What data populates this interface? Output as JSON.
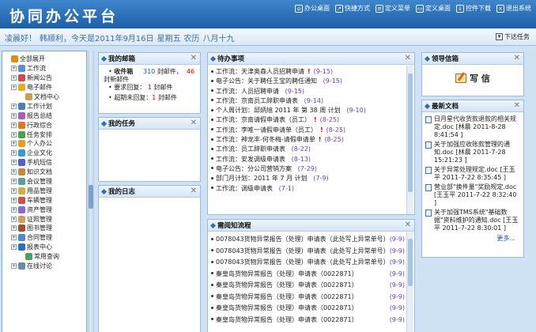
{
  "header": {
    "title": "协同办公平台",
    "nav": [
      {
        "label": "办公桌面",
        "icon": "home-icon"
      },
      {
        "label": "快捷方式",
        "icon": "shortcut-icon"
      },
      {
        "label": "定义菜单",
        "icon": "menu-icon"
      },
      {
        "label": "定义桌面",
        "icon": "desktop-icon"
      },
      {
        "label": "控件下载",
        "icon": "download-icon"
      },
      {
        "label": "退出系统",
        "icon": "exit-icon"
      }
    ]
  },
  "greeting": {
    "parts": [
      "凌晨好！",
      "韩顺利，今天是2011年9月16日",
      "星期五",
      "农历",
      "八月十九"
    ],
    "download_tasks": "下达任务"
  },
  "sidebar": {
    "items": [
      {
        "label": "全部展开",
        "level": 1,
        "exp": "",
        "color": "#e08a1a"
      },
      {
        "label": "工作流",
        "level": 2,
        "exp": "+",
        "color": "#5a8fd0"
      },
      {
        "label": "新闻公告",
        "level": 2,
        "exp": "+",
        "color": "#d04a4a"
      },
      {
        "label": "电子邮件",
        "level": 2,
        "exp": "+",
        "color": "#e0b020"
      },
      {
        "label": "文档中心",
        "level": 3,
        "exp": "",
        "color": "#c8a050"
      },
      {
        "label": "工作计划",
        "level": 2,
        "exp": "+",
        "color": "#4a7fc0"
      },
      {
        "label": "报告总结",
        "level": 2,
        "exp": "+",
        "color": "#b05ab0"
      },
      {
        "label": "行政综合",
        "level": 2,
        "exp": "+",
        "color": "#e07a20"
      },
      {
        "label": "任务安排",
        "level": 2,
        "exp": "+",
        "color": "#4aa04a"
      },
      {
        "label": "个人办公",
        "level": 2,
        "exp": "+",
        "color": "#e0a020"
      },
      {
        "label": "企业文化",
        "level": 2,
        "exp": "+",
        "color": "#3a9ad0"
      },
      {
        "label": "手机短信",
        "level": 2,
        "exp": "+",
        "color": "#5a5ad0"
      },
      {
        "label": "知识文档",
        "level": 2,
        "exp": "+",
        "color": "#c08a40"
      },
      {
        "label": "会议管理",
        "level": 2,
        "exp": "+",
        "color": "#5aa0a0"
      },
      {
        "label": "用品管理",
        "level": 2,
        "exp": "+",
        "color": "#d0b040"
      },
      {
        "label": "车辆管理",
        "level": 2,
        "exp": "+",
        "color": "#d05050"
      },
      {
        "label": "资产管理",
        "level": 2,
        "exp": "+",
        "color": "#8a6ad0"
      },
      {
        "label": "证照管理",
        "level": 2,
        "exp": "+",
        "color": "#d0a060"
      },
      {
        "label": "图书管理",
        "level": 2,
        "exp": "+",
        "color": "#a05030"
      },
      {
        "label": "合同管理",
        "level": 2,
        "exp": "+",
        "color": "#4a8ad0"
      },
      {
        "label": "报表中心",
        "level": 2,
        "exp": "+",
        "color": "#2a70c0"
      },
      {
        "label": "常用查询",
        "level": 3,
        "exp": "",
        "color": "#4aa060"
      },
      {
        "label": "在线讨论",
        "level": 2,
        "exp": "+",
        "color": "#6a8ab0"
      }
    ]
  },
  "mailbox": {
    "title": "我的邮箱",
    "inbox_label": "收件箱",
    "inbox_total": "310",
    "total_unit": "封邮件，",
    "inbox_new": "46",
    "new_unit": "封新邮件",
    "reply_label": "要求回复：",
    "reply_count": "1",
    "reply_unit": "封邮件",
    "overdue_label": "超期未回复：",
    "overdue_count": "1",
    "overdue_unit": "封邮件"
  },
  "my_tasks": {
    "title": "我的任务"
  },
  "my_diary": {
    "title": "我的日志"
  },
  "todo": {
    "title": "待办事项",
    "items": [
      {
        "text": "工作流：天津奥森人员招聘申请",
        "flag": true,
        "date": "(9-15)"
      },
      {
        "text": "电子公告：关于聘任王宝的聘任通知",
        "flag": false,
        "date": "(9-15)"
      },
      {
        "text": "工作流：人员招聘申请",
        "flag": false,
        "date": "(9-15)"
      },
      {
        "text": "工作流：京南员工辞职申请表",
        "flag": false,
        "date": "(9-14)"
      },
      {
        "text": "个人周计划：邱炳旭 2011 年 第 38 周 计划",
        "flag": false,
        "date": "(9-10)"
      },
      {
        "text": "工作流：京南请假申请表（员工）",
        "flag": true,
        "date": "(8-25)"
      },
      {
        "text": "工作流：李唯一请假申请单（员工）",
        "flag": true,
        "date": "(8-25)"
      },
      {
        "text": "工作流：神龙丰-何冬梅-请假申请单",
        "flag": true,
        "date": "(8-25)"
      },
      {
        "text": "工作流：员工辞职申请表",
        "flag": false,
        "date": "(8-22)"
      },
      {
        "text": "工作流：安发调级申请表",
        "flag": false,
        "date": "(8-13)"
      },
      {
        "text": "电子公告：分公司营销方案",
        "flag": false,
        "date": "(7-29)"
      },
      {
        "text": "部门月计划：2011 年 7 月 计划",
        "flag": false,
        "date": "(7-9)"
      },
      {
        "text": "工作流：调级申请表",
        "flag": false,
        "date": "(7-1)"
      }
    ]
  },
  "review_flow": {
    "title": "需阅知流程",
    "items": [
      {
        "text": "0078043货物异常报告（处理）申请表（此处写上异常单号）",
        "date": "(9-9)"
      },
      {
        "text": "0078043货物异常报告（处理）申请表（此处写上异常单号）",
        "date": "(9-9)"
      },
      {
        "text": "0078043货物异常报告（处理）申请表（此处写上异常单号）",
        "date": "(9-9)"
      },
      {
        "text": "秦皇岛货物异常报告（处理）申请表（0022871）",
        "date": "(9-9)"
      },
      {
        "text": "秦皇岛货物异常报告（处理）申请表（0022871）",
        "date": "(9-9)"
      },
      {
        "text": "秦皇岛货物异常报告（处理）申请表（0022871）",
        "date": "(9-9)"
      },
      {
        "text": "秦皇岛货物异常报告（处理）申请表（0022871）",
        "date": "(9-9)"
      },
      {
        "text": "秦皇岛货物异常报告（处理）申请表（0022871）",
        "date": "(9-9)"
      }
    ]
  },
  "leader_mailbox": {
    "title": "领导信箱",
    "write_label": "写 信"
  },
  "latest_docs": {
    "title": "最新文档",
    "items": [
      {
        "line1": "日月星代收货款退款的相关规定.doc",
        "author": "[林晨",
        "date": "2011-8-28",
        "time": "8:41:54 ]"
      },
      {
        "line1": "关于加强应收账款管理的通知.doc",
        "author": "[林晨",
        "date": "2011-7-28",
        "time": "15:21:23 ]"
      },
      {
        "line1": "关于异常处理规定.doc",
        "author": "[王玉平",
        "date": "2011-7-22",
        "time": "8:35:45 ]"
      },
      {
        "line1": "营业部\"换件量\"奖励规定.doc",
        "author": "[王玉平",
        "date": "2011-7-22",
        "time": "8:32:40 ]"
      },
      {
        "line1": "关于加强TMS系统\"基础数据\"资料维护的通知.doc",
        "author": "[王玉平",
        "date": "2011-7-22",
        "time": "8:30:01 ]"
      }
    ],
    "more": "更多..."
  }
}
